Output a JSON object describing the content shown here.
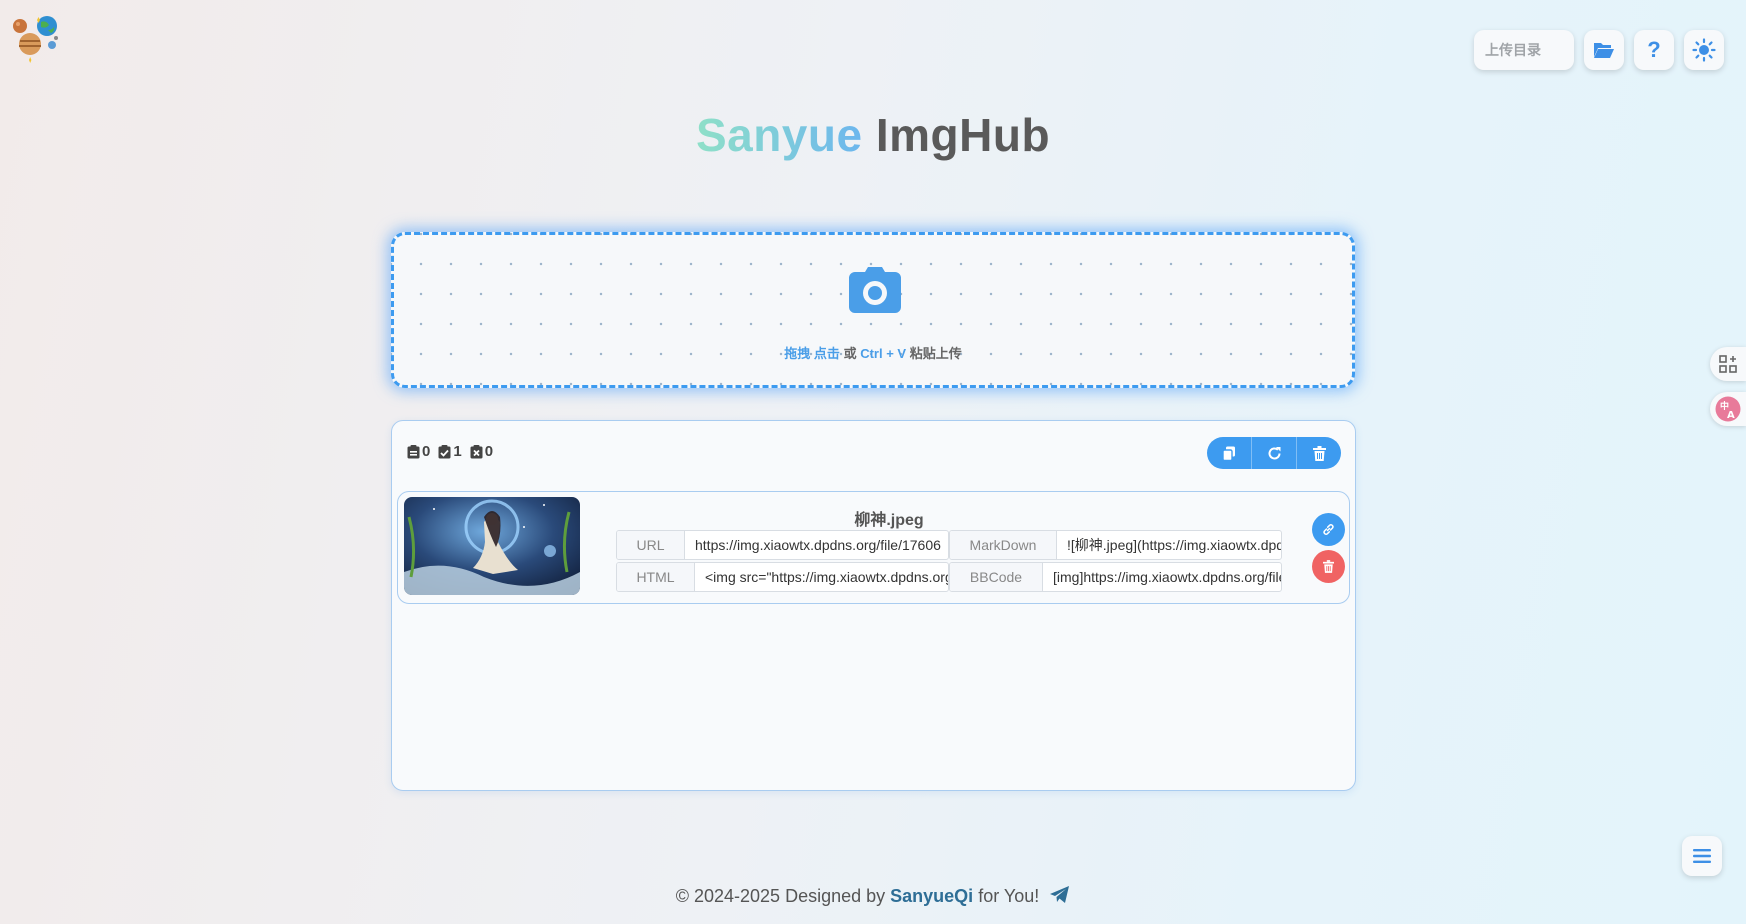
{
  "header": {
    "upload_dir_placeholder": "上传目录",
    "folder_icon": "folder-open-icon",
    "help_icon": "question-icon",
    "theme_icon": "sun-icon",
    "help_label": "?"
  },
  "title": {
    "part1": "Sanyue",
    "part2": "ImgHub"
  },
  "upload": {
    "icon": "camera-icon",
    "hint_drag": "拖拽",
    "hint_click": "点击",
    "hint_or": "或",
    "hint_shortcut": "Ctrl + V",
    "hint_paste": "粘贴上传"
  },
  "stats": {
    "pending": "0",
    "success": "1",
    "failed": "0"
  },
  "actions": {
    "copy_icon": "copy-icon",
    "refresh_icon": "refresh-icon",
    "delete_icon": "trash-icon"
  },
  "file": {
    "name": "柳神.jpeg",
    "links": {
      "url": {
        "label": "URL",
        "value": "https://img.xiaowtx.dpdns.org/file/17606"
      },
      "markdown": {
        "label": "MarkDown",
        "value": "![柳神.jpeg](https://img.xiaowtx.dpdns"
      },
      "html": {
        "label": "HTML",
        "value": "<img src=\"https://img.xiaowtx.dpdns.org"
      },
      "bbcode": {
        "label": "BBCode",
        "value": "[img]https://img.xiaowtx.dpdns.org/file"
      }
    }
  },
  "footer": {
    "prefix": "© 2024-2025 Designed by",
    "author": "SanyueQi",
    "suffix": "for You!"
  },
  "colors": {
    "accent": "#3d9bf0",
    "danger": "#f06363",
    "author": "#2e6e96"
  }
}
